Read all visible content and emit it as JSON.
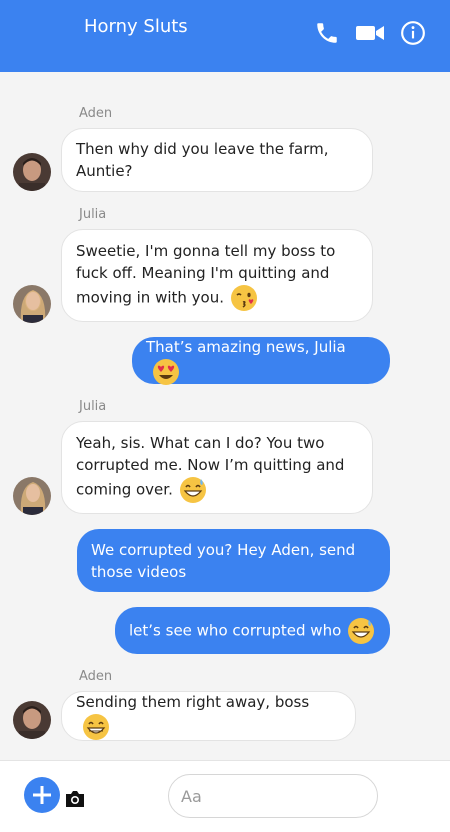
{
  "header": {
    "title": "Horny Sluts",
    "icons": [
      "phone-icon",
      "video-icon",
      "info-icon"
    ]
  },
  "messages": [
    {
      "sender": "Aden",
      "text": "Then why did you leave the farm, Auntie?",
      "side": "in"
    },
    {
      "sender": "Julia",
      "text": "Sweetie, I'm gonna tell my boss to fuck off. Meaning I'm quitting and moving in with you.",
      "emoji": "kissing-wink-emoji",
      "side": "in"
    },
    {
      "text": "That’s amazing news, Julia",
      "emoji": "heart-eyes-emoji",
      "side": "out"
    },
    {
      "sender": "Julia",
      "text": "Yeah, sis. What can I do? You two corrupted me. Now I’m quitting and coming over.",
      "emoji": "grin-sweat-emoji",
      "side": "in"
    },
    {
      "text": "We corrupted you? Hey Aden, send those videos",
      "side": "out"
    },
    {
      "text": "let’s see who corrupted who",
      "emoji": "grin-sweat-emoji",
      "side": "out"
    },
    {
      "sender": "Aden",
      "text": "Sending them right away, boss",
      "emoji": "grin-emoji",
      "side": "in"
    }
  ],
  "composer": {
    "placeholder": "Aa",
    "icons": [
      "plus-icon",
      "camera-icon"
    ]
  },
  "colors": {
    "accent": "#3b82f0",
    "chat_background": "#f4f4f4"
  }
}
